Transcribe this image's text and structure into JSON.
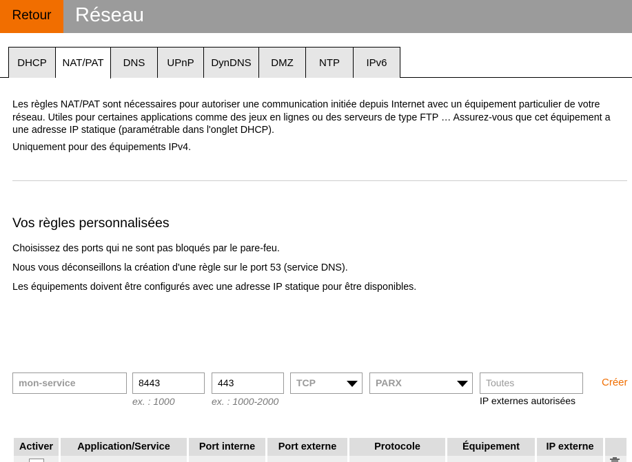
{
  "header": {
    "back_label": "Retour",
    "title": "Réseau"
  },
  "tabs": [
    {
      "label": "DHCP",
      "active": false
    },
    {
      "label": "NAT/PAT",
      "active": true
    },
    {
      "label": "DNS",
      "active": false
    },
    {
      "label": "UPnP",
      "active": false
    },
    {
      "label": "DynDNS",
      "active": false
    },
    {
      "label": "DMZ",
      "active": false
    },
    {
      "label": "NTP",
      "active": false
    },
    {
      "label": "IPv6",
      "active": false
    }
  ],
  "intro": {
    "text": "Les règles NAT/PAT sont nécessaires pour autoriser une communication initiée depuis Internet avec un équipement particulier de votre réseau. Utiles pour certaines applications comme des jeux en lignes ou des serveurs de type FTP … Assurez-vous que cet équipement a une adresse IP statique (paramétrable dans l'onglet DHCP).",
    "ipv4_note": "Uniquement pour des équipements IPv4."
  },
  "custom_rules": {
    "title": "Vos règles personnalisées",
    "lines": [
      "Choisissez des ports qui ne sont pas bloqués par le pare-feu.",
      "Nous vous déconseillons la création d'une règle sur le port 53 (service DNS).",
      "Les équipements doivent être configurés avec une adresse IP statique pour être disponibles."
    ]
  },
  "form": {
    "service_placeholder": "mon-service",
    "internal_port_value": "8443",
    "internal_port_hint": "ex. : 1000",
    "external_port_value": "443",
    "external_port_hint": "ex. : 1000-2000",
    "protocol_value": "TCP",
    "device_value": "PARX",
    "external_ip_placeholder": "Toutes",
    "external_ip_hint": "IP externes autorisées",
    "create_label": "Créer"
  },
  "table": {
    "headers": [
      "Activer",
      "Application/Service",
      "Port interne",
      "Port externe",
      "Protocole",
      "Équipement",
      "IP externe",
      ""
    ]
  },
  "colors": {
    "accent": "#f16e00",
    "header_bg": "#9b9b9b"
  },
  "icons": [
    "chevron-down-icon",
    "trash-icon"
  ]
}
